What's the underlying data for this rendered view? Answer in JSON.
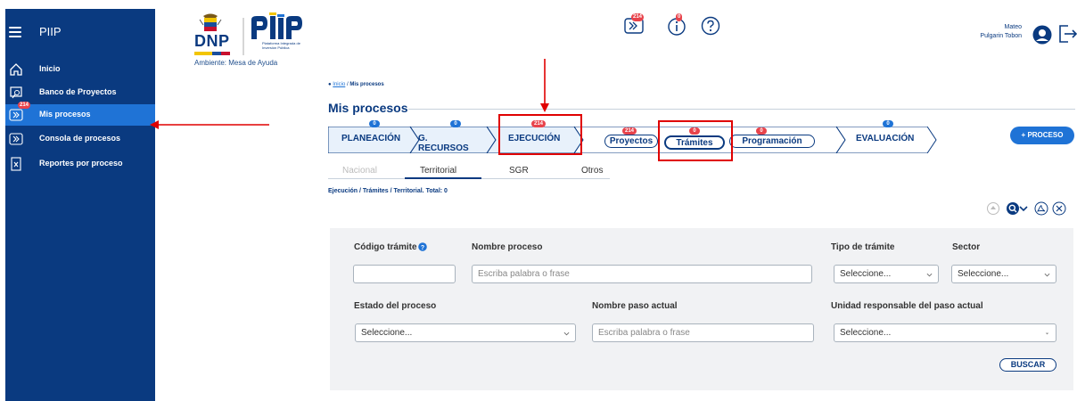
{
  "sidebar": {
    "title": "PIIP",
    "items": [
      {
        "label": "Inicio",
        "icon": "home-icon"
      },
      {
        "label": "Banco de Proyectos",
        "icon": "project-bank-icon"
      },
      {
        "label": "Mis procesos",
        "icon": "processes-icon",
        "badge": "214",
        "active": true
      },
      {
        "label": "Consola de procesos",
        "icon": "console-icon"
      },
      {
        "label": "Reportes por proceso",
        "icon": "report-icon"
      }
    ]
  },
  "header": {
    "logo_text": "DNP",
    "logo_subtitle": "Plataforma Integrada de Inversión Pública",
    "environment": "Ambiente: Mesa de Ayuda",
    "processes_badge": "214",
    "info_badge": "0",
    "user_first": "Mateo",
    "user_last": "Pulgarin Tobon"
  },
  "breadcrumb": {
    "home": "Inicio",
    "separator": "/",
    "current": "Mis procesos"
  },
  "page_title": "Mis procesos",
  "steps": [
    {
      "label": "PLANEACIÓN",
      "badge": "0"
    },
    {
      "label": "G. RECURSOS",
      "badge": "0"
    },
    {
      "label": "EJECUCIÓN",
      "badge": "214"
    },
    {
      "label": "EVALUACIÓN",
      "badge": "0"
    }
  ],
  "ejecucion_tabs": [
    {
      "label": "Proyectos",
      "badge": "214"
    },
    {
      "label": "Trámites",
      "badge": "0",
      "active": true
    },
    {
      "label": "Programación",
      "badge": "0"
    }
  ],
  "new_process_button": "+ PROCESO",
  "subtabs": [
    {
      "label": "Nacional",
      "disabled": true
    },
    {
      "label": "Territorial",
      "active": true
    },
    {
      "label": "SGR"
    },
    {
      "label": "Otros"
    }
  ],
  "summary": "Ejecución / Trámites / Territorial. Total: 0",
  "filters": {
    "codigo_label": "Código trámite",
    "codigo_value": "",
    "nombre_label": "Nombre proceso",
    "nombre_placeholder": "Escriba palabra o frase",
    "tipo_label": "Tipo de trámite",
    "tipo_value": "Seleccione...",
    "sector_label": "Sector",
    "sector_value": "Seleccione...",
    "estado_label": "Estado del proceso",
    "estado_value": "Seleccione...",
    "paso_label": "Nombre paso actual",
    "paso_placeholder": "Escriba palabra o frase",
    "unidad_label": "Unidad responsable del paso actual",
    "unidad_value": "Seleccione...",
    "search_button": "BUSCAR"
  },
  "colors": {
    "sidebar": "#0a3a80",
    "accent": "#1f73d6",
    "badge": "#e8434b",
    "highlight": "#e00000"
  }
}
